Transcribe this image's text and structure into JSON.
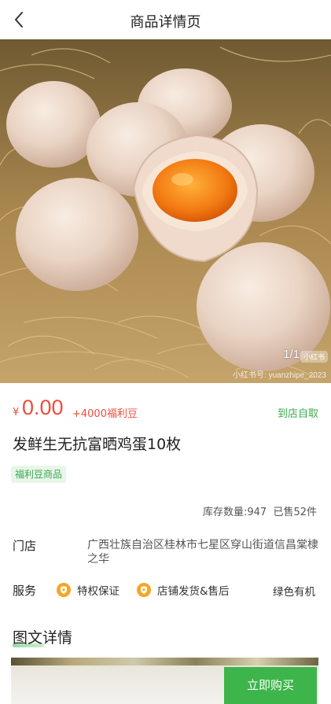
{
  "header": {
    "title": "商品详情页"
  },
  "gallery": {
    "counter": "1/1",
    "watermark_logo": "小红书",
    "watermark_text": "小红书号: yuanzhipe_2023"
  },
  "price": {
    "currency": "¥",
    "value": "0.00",
    "bonus": "+4000福利豆",
    "delivery": "到店自取"
  },
  "product": {
    "title": "发鲜生无抗富晒鸡蛋10枚",
    "tag": "福利豆商品"
  },
  "stats": {
    "text": "库存数量:947  已售52件"
  },
  "store": {
    "label": "门店",
    "address": "广西壮族自治区桂林市七星区穿山街道信昌棠棣之华"
  },
  "service": {
    "label": "服务",
    "items": [
      "特权保证",
      "店铺发货&售后"
    ],
    "green": "绿色有机"
  },
  "detail": {
    "title": "图文详情"
  },
  "actions": {
    "buy": "立即购买"
  },
  "colors": {
    "price": "#f24b3c",
    "accent_green": "#3db54a",
    "tag_bg": "#e8f6ea",
    "service_icon": "#f5a623"
  }
}
